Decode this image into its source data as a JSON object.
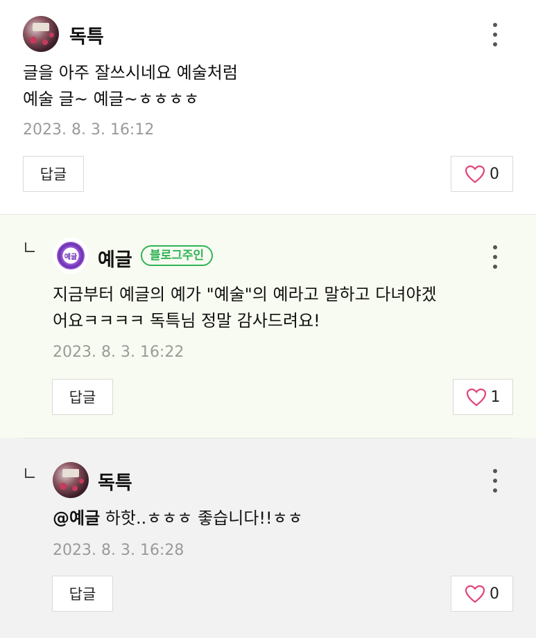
{
  "comments": [
    {
      "author": "독특",
      "text_lines": [
        "글을 아주 잘쓰시네요 예술처럼",
        "예술 글~ 예글~ㅎㅎㅎㅎ"
      ],
      "date": "2023. 8. 3. 16:12",
      "reply_label": "답글",
      "likes": "0",
      "is_reply": false,
      "avatar": "profile-photo"
    },
    {
      "author": "예글",
      "badge": "블로그주인",
      "text_lines": [
        "지금부터 예글의 예가 \"예술\"의 예라고 말하고 다녀야겠",
        "어요ㅋㅋㅋㅋ 독특님 정말 감사드려요!"
      ],
      "date": "2023. 8. 3. 16:22",
      "reply_label": "답글",
      "likes": "1",
      "is_reply": true,
      "avatar_logo_text": "예글",
      "colors": {
        "badge": "#2fb355",
        "background": "#f8fbf1"
      }
    },
    {
      "author": "독특",
      "mention": "@예글",
      "text": " 하핫..ㅎㅎㅎ 좋습니다!!ㅎㅎ",
      "date": "2023. 8. 3. 16:28",
      "reply_label": "답글",
      "likes": "0",
      "is_reply": true,
      "avatar": "profile-photo"
    }
  ],
  "icons": {
    "more": "more-vertical-icon",
    "like": "heart-icon",
    "reply": "reply-arrow-icon"
  },
  "colors": {
    "heart": "#e0457b",
    "date": "#9a9a9a"
  }
}
